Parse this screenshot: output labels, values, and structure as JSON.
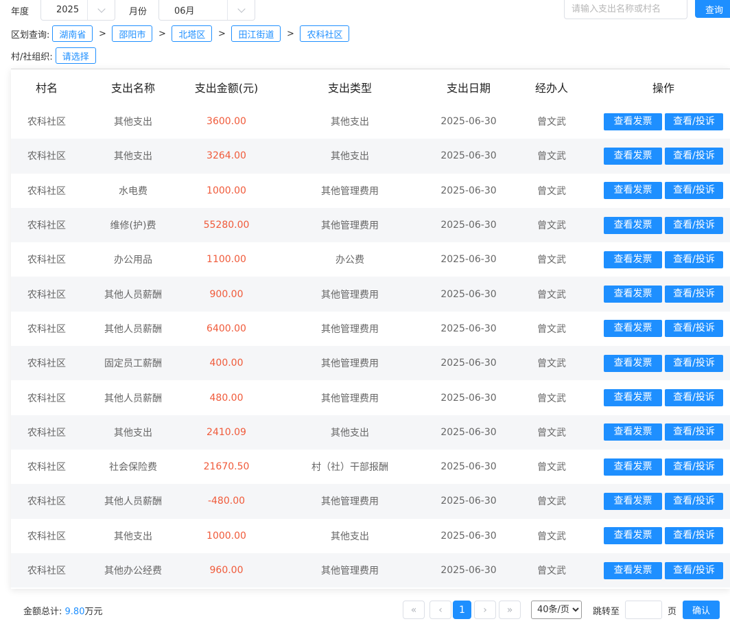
{
  "filters": {
    "year_label": "年度",
    "year_value": "2025",
    "month_label": "月份",
    "month_value": "06月",
    "search_placeholder": "请输入支出名称或村名",
    "query_label": "查询"
  },
  "region": {
    "label": "区划查询:",
    "levels": [
      "湖南省",
      "邵阳市",
      "北塔区",
      "田江街道",
      "农科社区"
    ],
    "separator": ">"
  },
  "org": {
    "label": "村/社组织:",
    "select_label": "请选择"
  },
  "table": {
    "headers": [
      "村名",
      "支出名称",
      "支出金额(元)",
      "支出类型",
      "支出日期",
      "经办人",
      "操作"
    ],
    "action_invoice": "查看发票",
    "action_complaint": "查看/投诉",
    "rows": [
      {
        "village": "农科社区",
        "name": "其他支出",
        "amount": "3600.00",
        "type": "其他支出",
        "date": "2025-06-30",
        "handler": "曾文武"
      },
      {
        "village": "农科社区",
        "name": "其他支出",
        "amount": "3264.00",
        "type": "其他支出",
        "date": "2025-06-30",
        "handler": "曾文武"
      },
      {
        "village": "农科社区",
        "name": "水电费",
        "amount": "1000.00",
        "type": "其他管理费用",
        "date": "2025-06-30",
        "handler": "曾文武"
      },
      {
        "village": "农科社区",
        "name": "维修(护)费",
        "amount": "55280.00",
        "type": "其他管理费用",
        "date": "2025-06-30",
        "handler": "曾文武"
      },
      {
        "village": "农科社区",
        "name": "办公用品",
        "amount": "1100.00",
        "type": "办公费",
        "date": "2025-06-30",
        "handler": "曾文武"
      },
      {
        "village": "农科社区",
        "name": "其他人员薪酬",
        "amount": "900.00",
        "type": "其他管理费用",
        "date": "2025-06-30",
        "handler": "曾文武"
      },
      {
        "village": "农科社区",
        "name": "其他人员薪酬",
        "amount": "6400.00",
        "type": "其他管理费用",
        "date": "2025-06-30",
        "handler": "曾文武"
      },
      {
        "village": "农科社区",
        "name": "固定员工薪酬",
        "amount": "400.00",
        "type": "其他管理费用",
        "date": "2025-06-30",
        "handler": "曾文武"
      },
      {
        "village": "农科社区",
        "name": "其他人员薪酬",
        "amount": "480.00",
        "type": "其他管理费用",
        "date": "2025-06-30",
        "handler": "曾文武"
      },
      {
        "village": "农科社区",
        "name": "其他支出",
        "amount": "2410.09",
        "type": "其他支出",
        "date": "2025-06-30",
        "handler": "曾文武"
      },
      {
        "village": "农科社区",
        "name": "社会保险费",
        "amount": "21670.50",
        "type": "村（社）干部报酬",
        "date": "2025-06-30",
        "handler": "曾文武"
      },
      {
        "village": "农科社区",
        "name": "其他人员薪酬",
        "amount": "-480.00",
        "type": "其他管理费用",
        "date": "2025-06-30",
        "handler": "曾文武"
      },
      {
        "village": "农科社区",
        "name": "其他支出",
        "amount": "1000.00",
        "type": "其他支出",
        "date": "2025-06-30",
        "handler": "曾文武"
      },
      {
        "village": "农科社区",
        "name": "其他办公经费",
        "amount": "960.00",
        "type": "其他管理费用",
        "date": "2025-06-30",
        "handler": "曾文武"
      }
    ]
  },
  "footer": {
    "total_label": "金额总计:",
    "total_value": "9.80",
    "total_unit": "万元",
    "current_page": "1",
    "page_size_option": "40条/页",
    "jump_label": "跳转至",
    "page_unit": "页",
    "confirm_label": "确认"
  },
  "colors": {
    "primary": "#1e8fff",
    "amount": "#f05a3a",
    "stripe": "#f5f6f8"
  }
}
